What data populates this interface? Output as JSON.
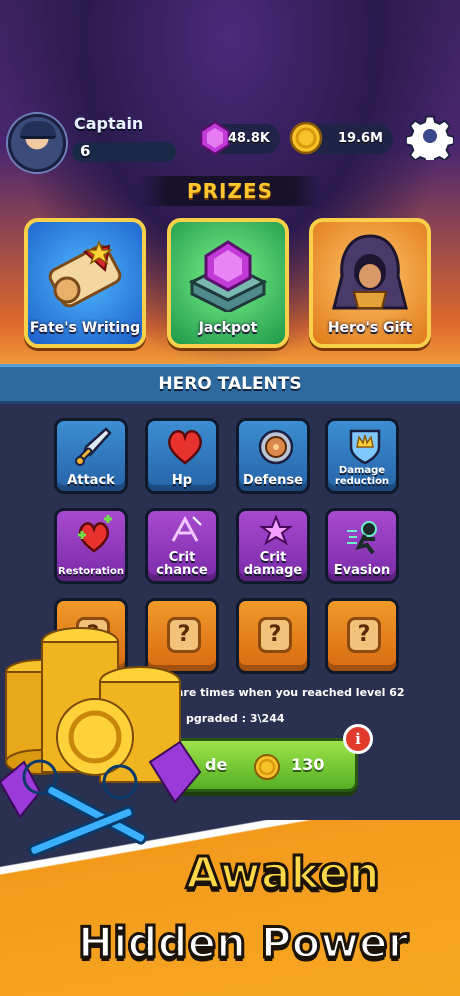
{
  "profile": {
    "name": "Captain",
    "level": "6"
  },
  "currency": {
    "gems": "48.8K",
    "coins": "19.6M"
  },
  "prizes": {
    "title": "PRIZES",
    "items": [
      {
        "label": "Fate's Writing"
      },
      {
        "label": "Jackpot"
      },
      {
        "label": "Hero's Gift"
      }
    ]
  },
  "talents": {
    "title": "HERO TALENTS",
    "row1": [
      "Attack",
      "Hp",
      "Defense",
      "Damage reduction"
    ],
    "row2": [
      "Restoration",
      "Crit chance",
      "Crit damage",
      "Evasion"
    ],
    "locked_symbol": "?",
    "info_line1": "are times when you reached level 62",
    "info_line2": "pgraded : 3\\244",
    "upgrade_button_label": "de",
    "upgrade_cost": "130",
    "info_badge": "i"
  },
  "promo": {
    "line1": "Awaken",
    "line2": "Hidden Power"
  },
  "colors": {
    "accent_gold": "#ffc62e",
    "talent_blue": "#2f6a9e",
    "upgrade_green": "#54b024",
    "promo_orange": "#f39a1d"
  }
}
